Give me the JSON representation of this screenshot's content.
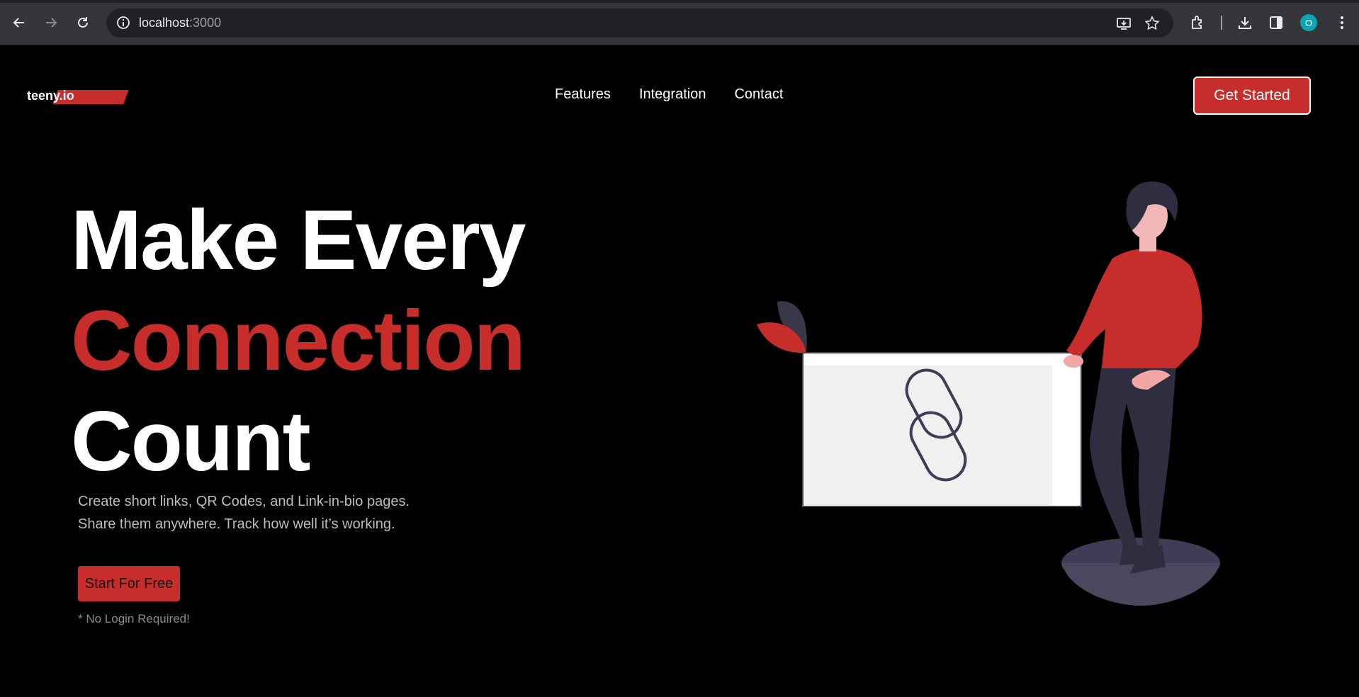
{
  "browser": {
    "url_host": "localhost",
    "url_port": ":3000",
    "profile_initial": "O",
    "icons": [
      "back-icon",
      "forward-icon",
      "reload-icon",
      "info-icon",
      "install-app-icon",
      "bookmark-star-icon",
      "extensions-icon",
      "downloads-icon",
      "side-panel-icon",
      "menu-icon"
    ]
  },
  "nav": {
    "logo_text": "teeny.io",
    "links": [
      "Features",
      "Integration",
      "Contact"
    ],
    "cta_label": "Get Started"
  },
  "hero": {
    "title_line1": "Make Every",
    "title_line2": "Connection",
    "title_line3": "Count",
    "subtitle_line1": "Create short links, QR Codes, and Link-in-bio pages.",
    "subtitle_line2": "Share them anywhere. Track how well it’s working.",
    "button_label": "Start For Free",
    "note": "* No Login Required!"
  },
  "colors": {
    "accent": "#c62d2b",
    "background": "#000000",
    "text": "#ffffff",
    "muted": "#bdbdbd"
  }
}
